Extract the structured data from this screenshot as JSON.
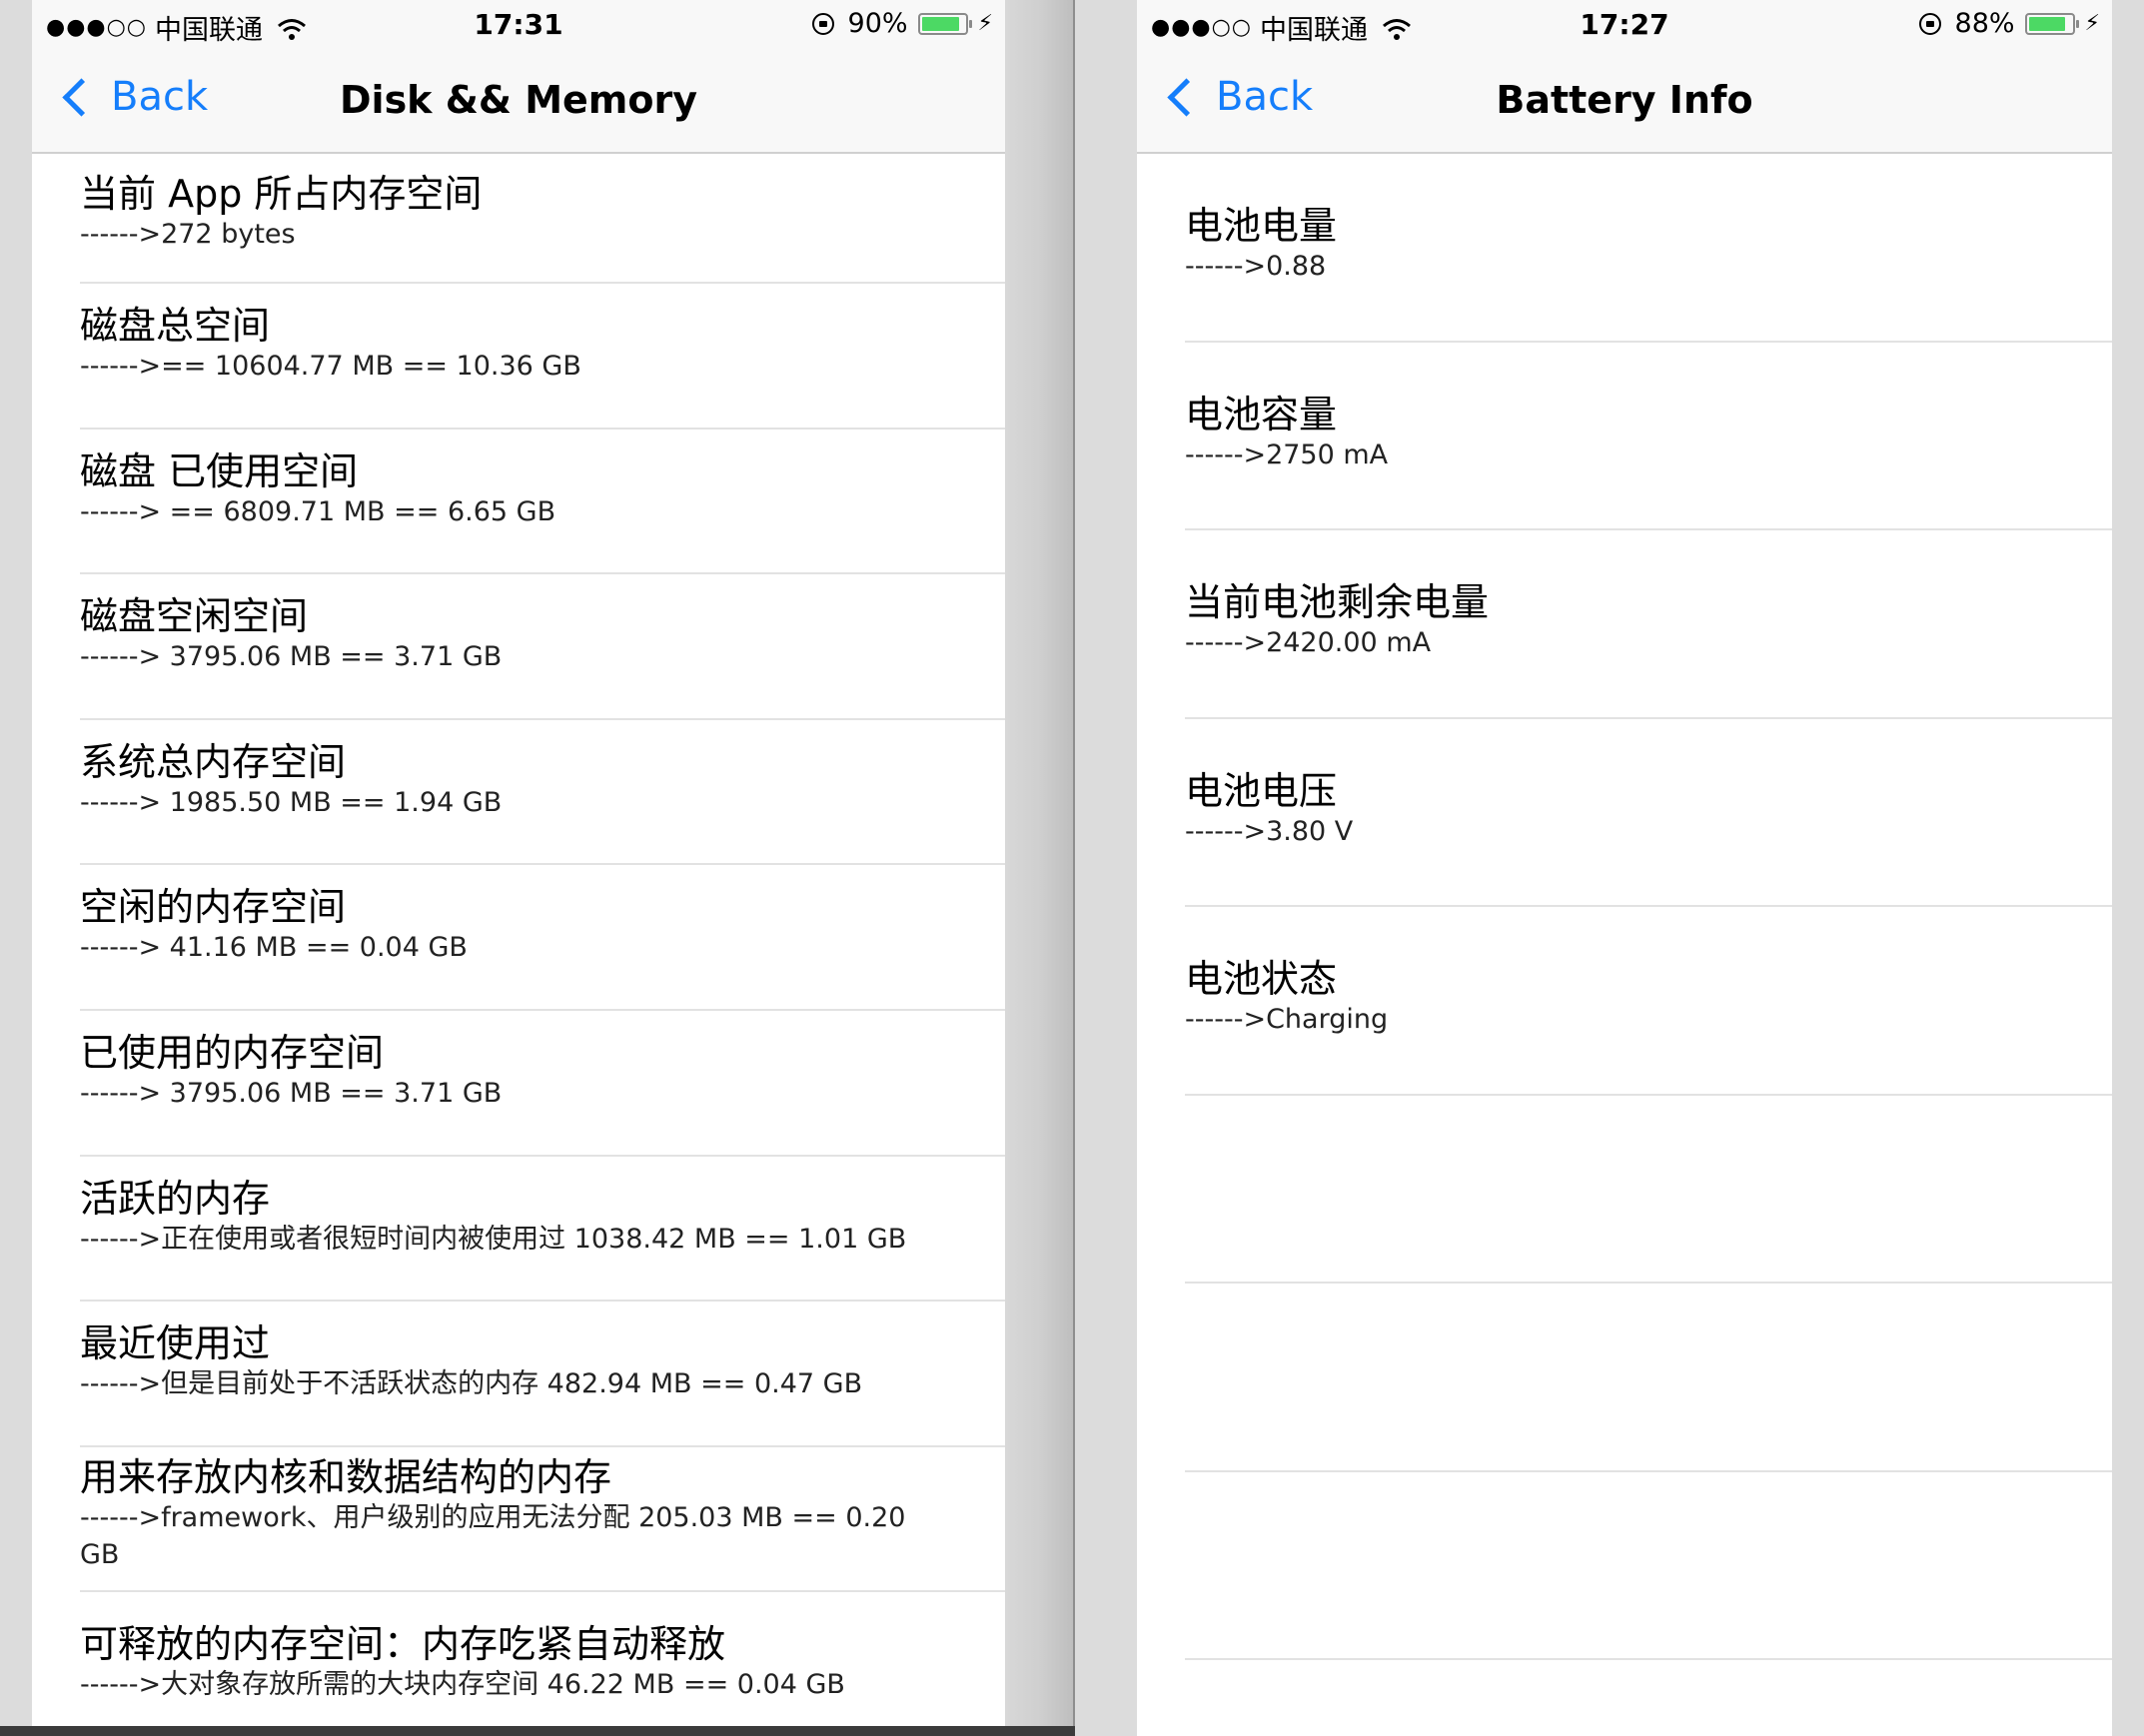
{
  "left_phone": {
    "status": {
      "dots": "●●●○○",
      "carrier": "中国联通",
      "time": "17:31",
      "battery": "90%",
      "battery_level": 0.9
    },
    "nav": {
      "back": "Back",
      "title": "Disk && Memory"
    },
    "rows": [
      {
        "title": "当前 App 所占内存空间",
        "detail": "------>272 bytes"
      },
      {
        "title": "磁盘总空间",
        "detail": "------>== 10604.77 MB == 10.36 GB"
      },
      {
        "title": "磁盘 已使用空间",
        "detail": "------> == 6809.71 MB == 6.65 GB"
      },
      {
        "title": "磁盘空闲空间",
        "detail": "------> 3795.06 MB == 3.71 GB"
      },
      {
        "title": "系统总内存空间",
        "detail": "------> 1985.50 MB == 1.94 GB"
      },
      {
        "title": "空闲的内存空间",
        "detail": "------> 41.16 MB == 0.04 GB"
      },
      {
        "title": "已使用的内存空间",
        "detail": "------> 3795.06 MB == 3.71 GB"
      },
      {
        "title": "活跃的内存",
        "detail": "------>正在使用或者很短时间内被使用过 1038.42 MB == 1.01 GB"
      },
      {
        "title": "最近使用过",
        "detail": "------>但是目前处于不活跃状态的内存 482.94 MB == 0.47 GB"
      },
      {
        "title": "用来存放内核和数据结构的内存",
        "detail": "------>framework、用户级别的应用无法分配 205.03 MB == 0.20 GB"
      },
      {
        "title": "可释放的内存空间：内存吃紧自动释放",
        "detail": "------>大对象存放所需的大块内存空间 46.22 MB == 0.04 GB"
      }
    ]
  },
  "right_phone": {
    "status": {
      "dots": "●●●○○",
      "carrier": "中国联通",
      "time": "17:27",
      "battery": "88%",
      "battery_level": 0.88
    },
    "nav": {
      "back": "Back",
      "title": "Battery Info"
    },
    "rows": [
      {
        "title": "电池电量",
        "detail": "------>0.88"
      },
      {
        "title": "电池容量",
        "detail": "------>2750 mA"
      },
      {
        "title": "当前电池剩余电量",
        "detail": "------>2420.00 mA"
      },
      {
        "title": "电池电压",
        "detail": "------>3.80 V"
      },
      {
        "title": "电池状态",
        "detail": "------>Charging"
      }
    ]
  },
  "icons": {
    "signal": "signal-dots-icon",
    "wifi": "wifi-icon",
    "lock": "orientation-lock-icon",
    "battery": "battery-icon",
    "charging": "charging-bolt-icon",
    "back": "chevron-left-icon"
  },
  "colors": {
    "link": "#157efb",
    "battery_fill": "#4cd964",
    "nav_bg": "#f8f8f8"
  }
}
